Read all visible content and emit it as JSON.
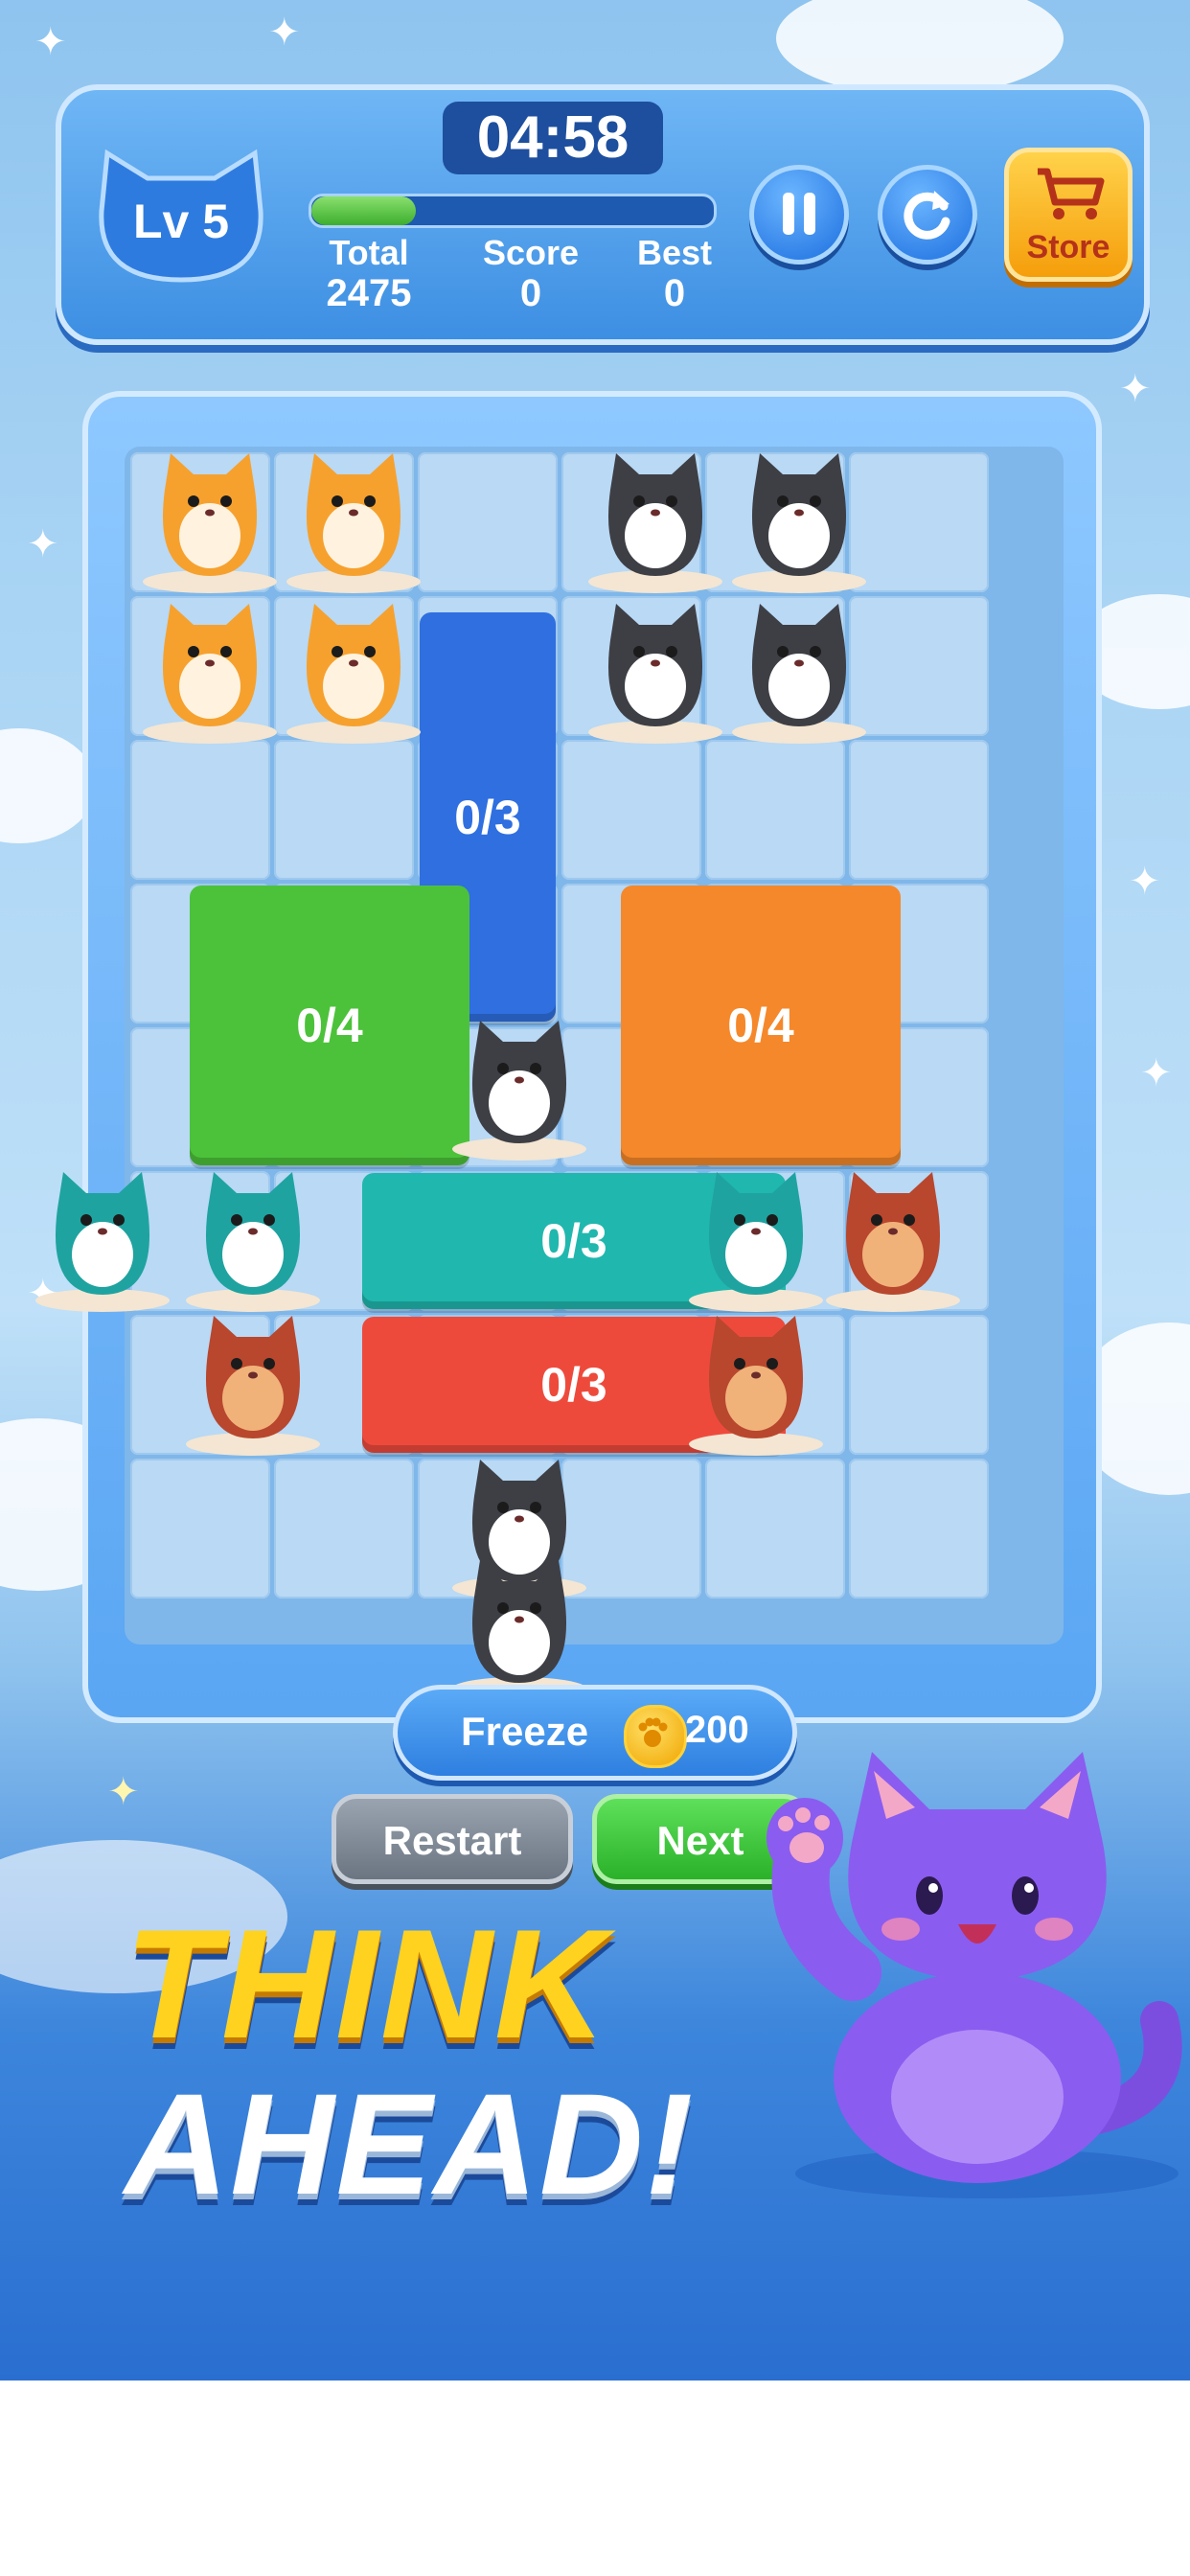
{
  "hud": {
    "level": "Lv 5",
    "timer": "04:58",
    "progress_fraction": 0.26,
    "stats": [
      {
        "label": "Total",
        "value": "2475"
      },
      {
        "label": "Score",
        "value": "0"
      },
      {
        "label": "Best",
        "value": "0"
      }
    ],
    "store_label": "Store"
  },
  "board": {
    "blocks": [
      {
        "name": "blue-block",
        "label": "0/3",
        "color": "#2f6fe0"
      },
      {
        "name": "green-block",
        "label": "0/4",
        "color": "#4cc23a"
      },
      {
        "name": "orange-block",
        "label": "0/4",
        "color": "#f5882a"
      },
      {
        "name": "teal-block",
        "label": "0/3",
        "color": "#20b7ae"
      },
      {
        "name": "red-block",
        "label": "0/3",
        "color": "#ee4a3c"
      }
    ]
  },
  "controls": {
    "freeze_label": "Freeze",
    "freeze_cost": "200",
    "restart_label": "Restart",
    "next_label": "Next"
  },
  "headline": {
    "line1": "THINK",
    "line2": "AHEAD!"
  }
}
